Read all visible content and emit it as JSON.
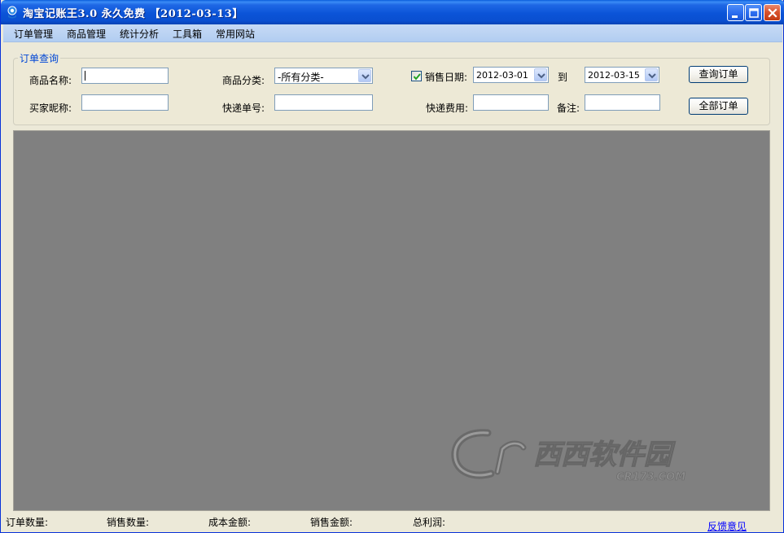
{
  "window": {
    "title": "淘宝记账王3.0 永久免费 【2012-03-13】"
  },
  "menu": [
    "订单管理",
    "商品管理",
    "统计分析",
    "工具箱",
    "常用网站"
  ],
  "query": {
    "group_title": "订单查询",
    "product_name_label": "商品名称:",
    "product_name_value": "",
    "category_label": "商品分类:",
    "category_value": "-所有分类-",
    "sale_date_checked": true,
    "sale_date_label": "销售日期:",
    "date_from": "2012-03-01",
    "date_to_label": "到",
    "date_to": "2012-03-15",
    "query_button": "查询订单",
    "buyer_label": "买家昵称:",
    "buyer_value": "",
    "tracking_label": "快递单号:",
    "tracking_value": "",
    "shipping_fee_label": "快递费用:",
    "shipping_fee_value": "",
    "remark_label": "备注:",
    "remark_value": "",
    "all_orders_button": "全部订单"
  },
  "status": {
    "order_count": "订单数量:",
    "sales_qty": "销售数量:",
    "cost_amount": "成本金额:",
    "sales_amount": "销售金额:",
    "total_profit": "总利润:",
    "feedback": "反馈意见"
  },
  "watermark": {
    "brand": "西西软件园",
    "domain": "CR173.COM"
  },
  "colors": {
    "titlebar": "#0a54d8",
    "menubar": "#c2d7f4",
    "content_bg": "#808080",
    "group_title": "#0046d5",
    "link": "#0000ff"
  }
}
